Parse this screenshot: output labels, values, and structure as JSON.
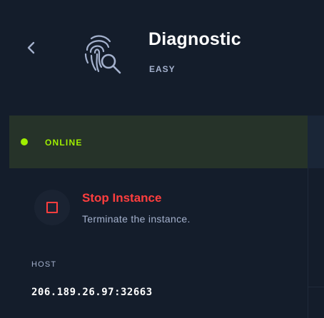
{
  "header": {
    "back_icon": "chevron-left-icon",
    "logo_icon": "fingerprint-search-icon",
    "title": "Diagnostic",
    "difficulty": "EASY"
  },
  "status": {
    "label": "ONLINE",
    "color": "#9fef00"
  },
  "stop_instance": {
    "icon": "stop-square-icon",
    "title": "Stop Instance",
    "description": "Terminate the instance.",
    "color": "#ff3e3e"
  },
  "host": {
    "label": "HOST",
    "value": "206.189.26.97:32663"
  }
}
